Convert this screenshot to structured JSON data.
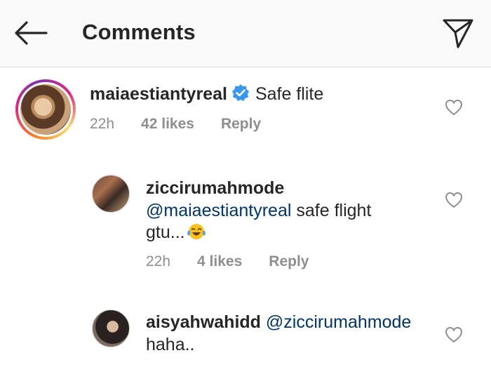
{
  "header": {
    "title": "Comments",
    "back_icon": "arrow-left-icon",
    "share_icon": "paper-plane-icon"
  },
  "comments": [
    {
      "username": "maiaestiantyreal",
      "verified": true,
      "text": "Safe flite",
      "time": "22h",
      "likes": "42 likes",
      "reply": "Reply"
    },
    {
      "username": "ziccirumahmode",
      "mention": "@maiaestiantyreal",
      "text_line1": "safe flight",
      "text_line2": "gtu...",
      "emoji": "face-with-tears-of-joy-icon",
      "time": "22h",
      "likes": "4 likes",
      "reply": "Reply"
    },
    {
      "username": "aisyahwahidd",
      "mention": "@ziccirumahmode",
      "text": "haha.."
    }
  ],
  "colors": {
    "text": "#262626",
    "meta": "#8e8e8e",
    "mention": "#003569",
    "verified": "#3897f0",
    "header_bg": "#fafafa"
  }
}
